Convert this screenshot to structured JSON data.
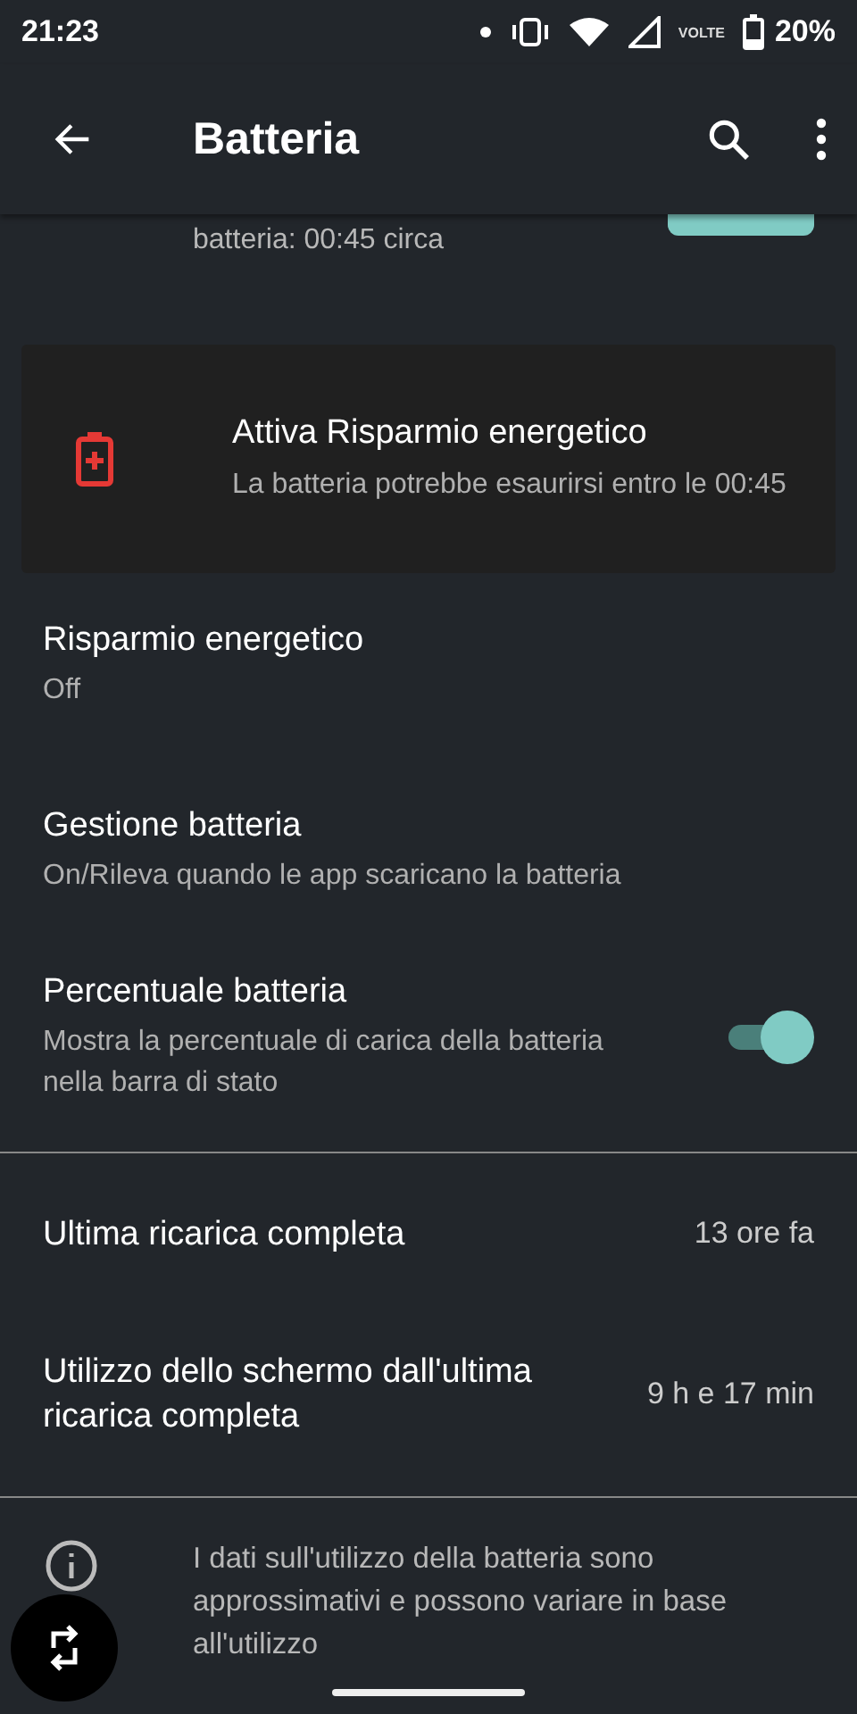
{
  "status_bar": {
    "time": "21:23",
    "network_label": "VOLTE",
    "battery_percent": "20%"
  },
  "app_bar": {
    "title": "Batteria"
  },
  "partial_row": {
    "text": "batteria: 00:45 circa"
  },
  "saver_card": {
    "title": "Attiva Risparmio energetico",
    "subtitle": "La batteria potrebbe esaurirsi entro le 00:45"
  },
  "settings": [
    {
      "kind": "plain",
      "title": "Risparmio energetico",
      "summary": "Off"
    },
    {
      "kind": "plain",
      "title": "Gestione batteria",
      "summary": "On/Rileva quando le app scaricano la batteria"
    },
    {
      "kind": "toggle",
      "title": "Percentuale batteria",
      "summary": "Mostra la percentuale di carica della batteria nella barra di stato",
      "on": true
    }
  ],
  "stats": [
    {
      "title": "Ultima ricarica completa",
      "value": "13 ore fa"
    },
    {
      "title": "Utilizzo dello schermo dall'ultima ricarica completa",
      "value": "9 h e 17 min"
    }
  ],
  "footer_note": "I dati sull'utilizzo della batteria sono approssimativi e possono variare in base all'utilizzo"
}
